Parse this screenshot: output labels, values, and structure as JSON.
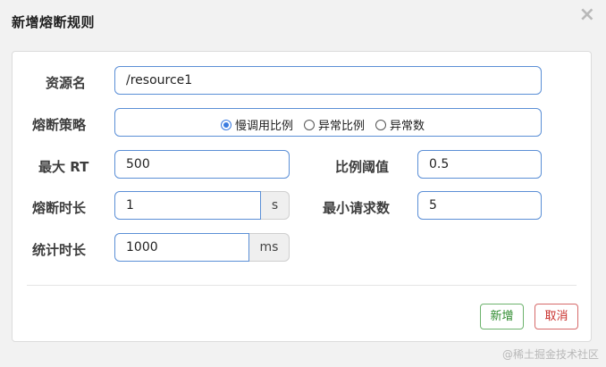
{
  "dialog": {
    "title": "新增熔断规则",
    "close_glyph": "×"
  },
  "form": {
    "resource": {
      "label": "资源名",
      "value": "/resource1"
    },
    "strategy": {
      "label": "熔断策略",
      "options": [
        {
          "label": "慢调用比例",
          "checked": true
        },
        {
          "label": "异常比例",
          "checked": false
        },
        {
          "label": "异常数",
          "checked": false
        }
      ]
    },
    "max_rt": {
      "label": "最大 RT",
      "value": "500"
    },
    "ratio_threshold": {
      "label": "比例阈值",
      "value": "0.5"
    },
    "break_duration": {
      "label": "熔断时长",
      "value": "1",
      "unit": "s"
    },
    "min_requests": {
      "label": "最小请求数",
      "value": "5"
    },
    "stat_duration": {
      "label": "统计时长",
      "value": "1000",
      "unit": "ms"
    }
  },
  "footer": {
    "add_label": "新增",
    "cancel_label": "取消"
  },
  "watermark": "@稀土掘金技术社区",
  "colors": {
    "input_border": "#5b8fd6",
    "radio_checked": "#3a7be0",
    "add_button": "#2e8b2e",
    "cancel_button": "#c9302c"
  }
}
